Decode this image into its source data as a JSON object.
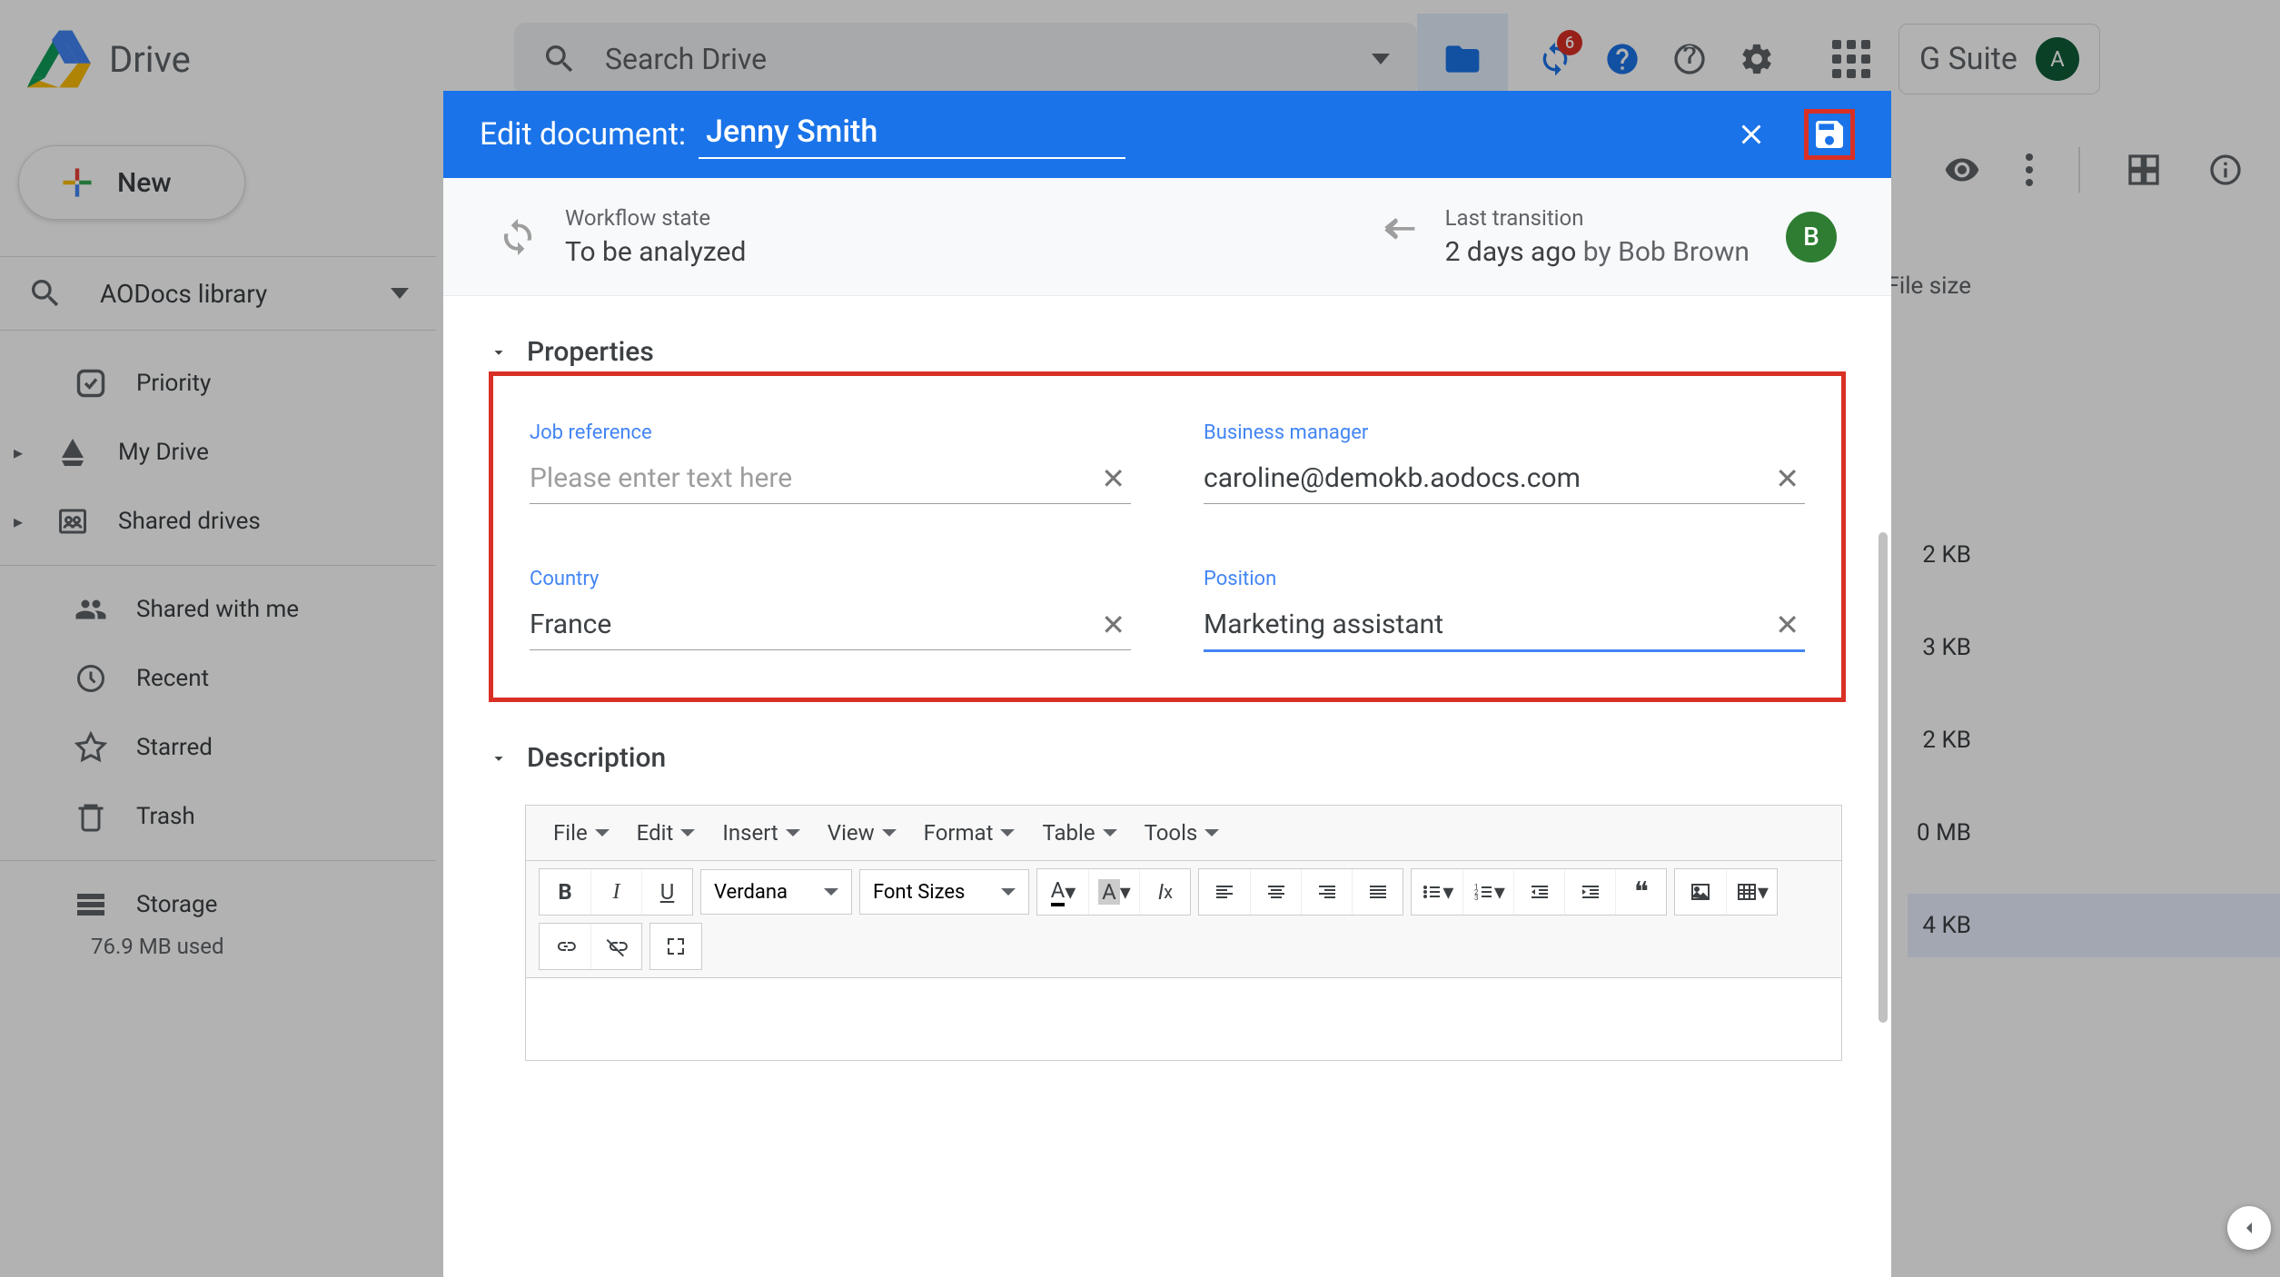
{
  "header": {
    "app_name": "Drive",
    "search_placeholder": "Search Drive",
    "badge_count": "6",
    "suite_label": "G Suite",
    "avatar_letter": "A"
  },
  "sidebar": {
    "new_label": "New",
    "library_label": "AODocs library",
    "items": [
      {
        "label": "Priority"
      },
      {
        "label": "My Drive"
      },
      {
        "label": "Shared drives"
      },
      {
        "label": "Shared with me"
      },
      {
        "label": "Recent"
      },
      {
        "label": "Starred"
      },
      {
        "label": "Trash"
      },
      {
        "label": "Storage"
      }
    ],
    "storage_used": "76.9 MB used"
  },
  "filelist": {
    "column_filesize": "File size",
    "sizes": [
      "2 KB",
      "3 KB",
      "2 KB",
      "0 MB",
      "4 KB"
    ]
  },
  "modal": {
    "title_label": "Edit document:",
    "doc_title": "Jenny Smith",
    "workflow": {
      "label": "Workflow state",
      "value": "To be analyzed"
    },
    "transition": {
      "label": "Last transition",
      "time": "2 days ago",
      "by_label": "by",
      "user": "Bob Brown",
      "avatar_letter": "B"
    },
    "sections": {
      "properties": "Properties",
      "description": "Description"
    },
    "fields": {
      "job_reference": {
        "label": "Job reference",
        "value": "",
        "placeholder": "Please enter text here"
      },
      "business_manager": {
        "label": "Business manager",
        "value": "caroline@demokb.aodocs.com"
      },
      "country": {
        "label": "Country",
        "value": "France"
      },
      "position": {
        "label": "Position",
        "value": "Marketing assistant"
      }
    },
    "rte": {
      "menus": [
        "File",
        "Edit",
        "Insert",
        "View",
        "Format",
        "Table",
        "Tools"
      ],
      "font_family": "Verdana",
      "font_size_label": "Font Sizes"
    }
  }
}
